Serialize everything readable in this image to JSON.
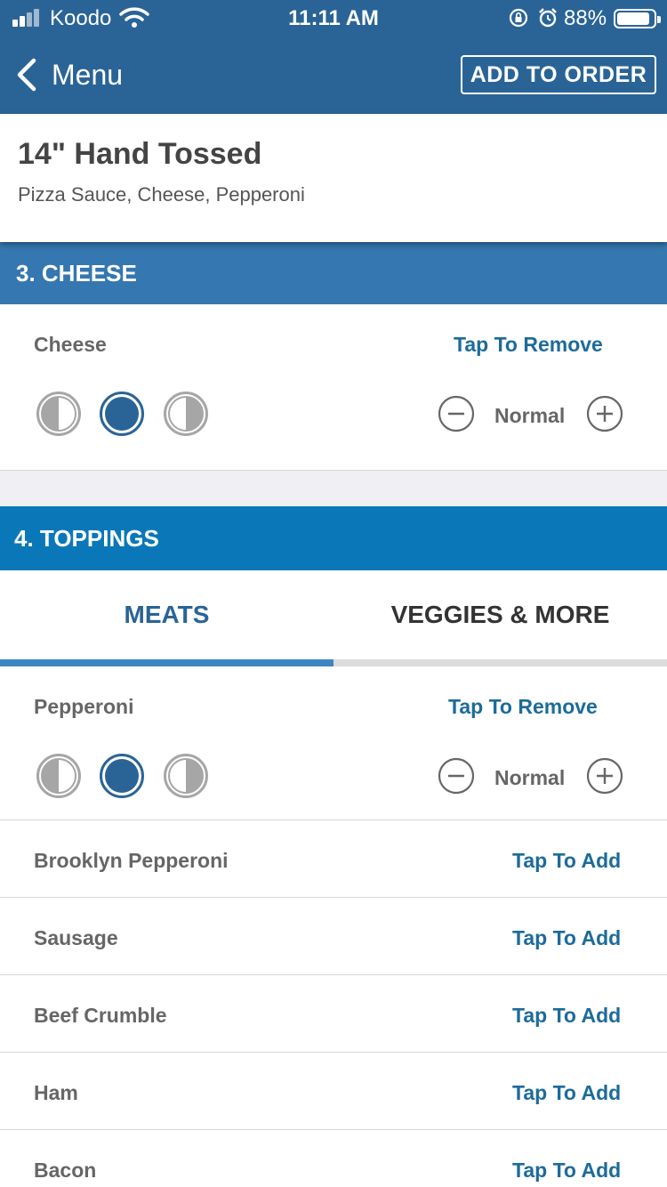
{
  "status": {
    "carrier": "Koodo",
    "time": "11:11 AM",
    "battery": "88%",
    "icons": [
      "signal-icon",
      "wifi-icon",
      "orientation-lock-icon",
      "alarm-icon",
      "battery-icon"
    ]
  },
  "nav": {
    "back_label": "Menu",
    "add_to_order": "ADD TO ORDER"
  },
  "product": {
    "title": "14\" Hand Tossed",
    "subtitle": "Pizza Sauce, Cheese, Pepperoni"
  },
  "cheese_section": {
    "title": "3. CHEESE",
    "item": {
      "name": "Cheese",
      "action": "Tap To Remove",
      "amount": "Normal",
      "portion_selected": "whole"
    }
  },
  "toppings_section": {
    "title": "4. TOPPINGS",
    "tabs": [
      {
        "label": "MEATS",
        "active": true
      },
      {
        "label": "VEGGIES & MORE",
        "active": false
      }
    ],
    "selected_item": {
      "name": "Pepperoni",
      "action": "Tap To Remove",
      "amount": "Normal",
      "portion_selected": "whole"
    },
    "items": [
      {
        "name": "Brooklyn Pepperoni",
        "action": "Tap To Add"
      },
      {
        "name": "Sausage",
        "action": "Tap To Add"
      },
      {
        "name": "Beef Crumble",
        "action": "Tap To Add"
      },
      {
        "name": "Ham",
        "action": "Tap To Add"
      },
      {
        "name": "Bacon",
        "action": "Tap To Add"
      }
    ]
  },
  "colors": {
    "header_blue": "#2a6496",
    "cheese_header": "#3577b0",
    "toppings_header": "#0a78b8",
    "link_blue": "#1d6b9a",
    "background_gray": "#efeff4"
  }
}
